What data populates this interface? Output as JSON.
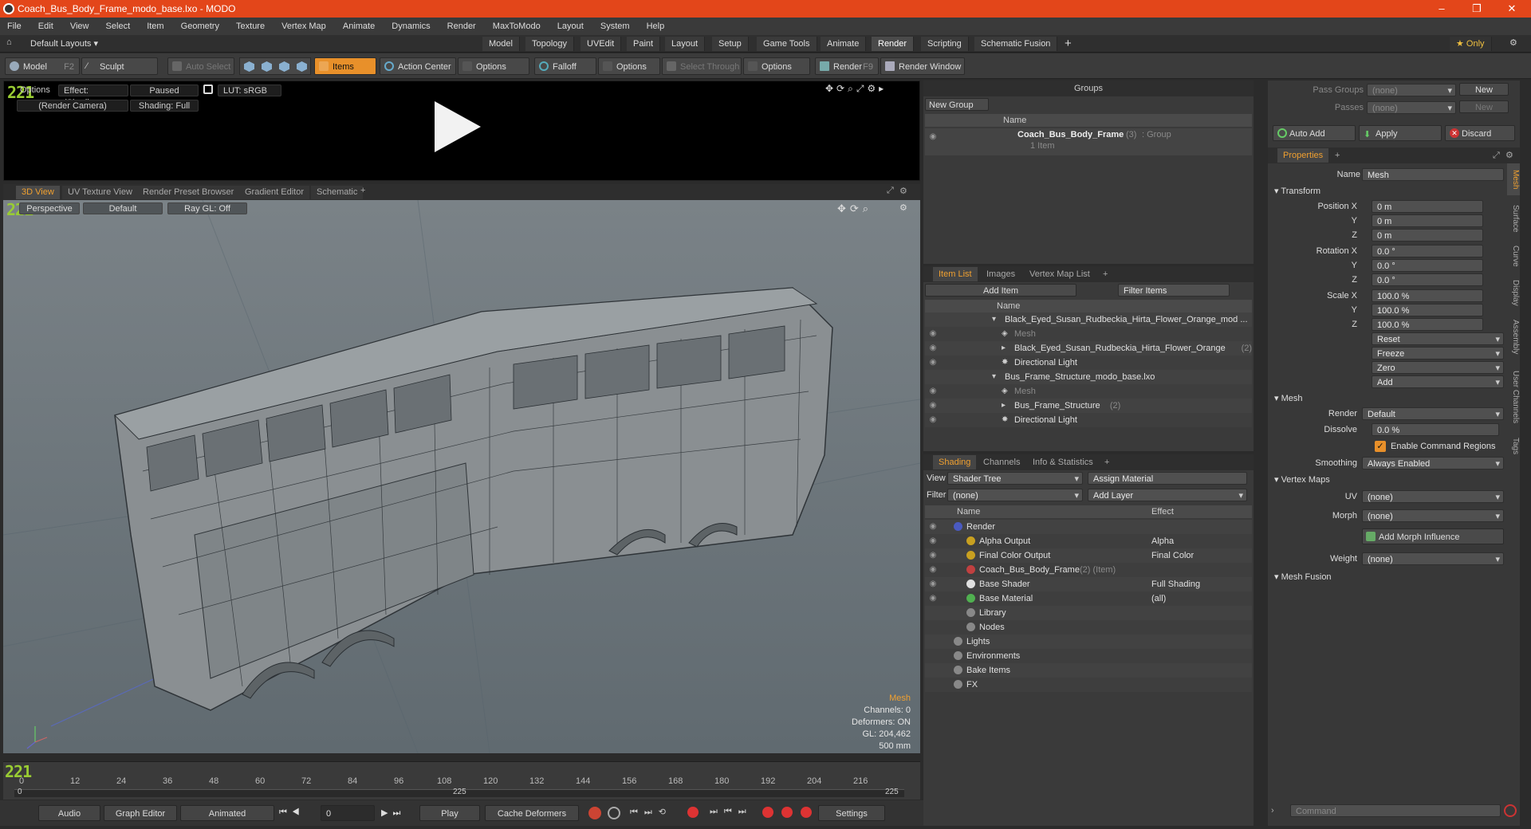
{
  "window": {
    "title": "Coach_Bus_Body_Frame_modo_base.lxo - MODO",
    "min": "–",
    "max": "❐",
    "close": "✕"
  },
  "menu": [
    "File",
    "Edit",
    "View",
    "Select",
    "Item",
    "Geometry",
    "Texture",
    "Vertex Map",
    "Animate",
    "Dynamics",
    "Render",
    "MaxToModo",
    "Layout",
    "System",
    "Help"
  ],
  "layout": {
    "default": "Default Layouts ▾",
    "tabs": [
      "Model",
      "Topology",
      "UVEdit",
      "Paint",
      "Layout",
      "Setup",
      "Game Tools",
      "Animate",
      "Render",
      "Scripting",
      "Schematic Fusion"
    ],
    "active": "Render",
    "plus": "+",
    "only": "★ Only"
  },
  "toolbar": {
    "model": "Model",
    "model_key": "F2",
    "sculpt": "Sculpt",
    "auto_select": "Auto Select",
    "items": "Items",
    "action_center": "Action Center",
    "options1": "Options",
    "falloff": "Falloff",
    "options2": "Options",
    "select_through": "Select Through",
    "options3": "Options",
    "render": "Render",
    "render_key": "F9",
    "render_window": "Render Window"
  },
  "preview": {
    "options": "Options",
    "effect": "Effect: (Shadi...",
    "paused": "Paused",
    "lut": "LUT: sRGB",
    "camera": "(Render Camera)",
    "shading": "Shading: Full",
    "frame_badge": "221"
  },
  "viewport_tabs": [
    "3D View",
    "UV Texture View",
    "Render Preset Browser",
    "Gradient Editor",
    "Schematic",
    "+"
  ],
  "viewport": {
    "perspective": "Perspective",
    "default": "Default",
    "raygl": "Ray GL: Off",
    "badge": "221",
    "info": {
      "type": "Mesh",
      "channels": "Channels: 0",
      "deformers": "Deformers: ON",
      "gl": "GL: 204,462",
      "size": "500 mm"
    }
  },
  "timeline": {
    "ticks": [
      "0",
      "12",
      "24",
      "36",
      "48",
      "60",
      "72",
      "84",
      "96",
      "108",
      "120",
      "132",
      "144",
      "156",
      "168",
      "180",
      "192",
      "204",
      "216"
    ],
    "mid": "225",
    "end": "225",
    "badge": "221"
  },
  "bottom": {
    "audio": "Audio",
    "graph": "Graph Editor",
    "animated": "Animated",
    "frame": "0",
    "play": "Play",
    "cache": "Cache Deformers",
    "settings": "Settings"
  },
  "groups": {
    "title": "Groups",
    "new_group": "New Group",
    "col_name": "Name",
    "item_name": "Coach_Bus_Body_Frame",
    "item_count": "(3)",
    "item_type": ": Group",
    "item_sub": "1 Item"
  },
  "itemlist": {
    "tabs": [
      "Item List",
      "Images",
      "Vertex Map List",
      "+"
    ],
    "add_item": "Add Item",
    "filter": "Filter Items",
    "col_name": "Name",
    "rows": [
      {
        "label": "Black_Eyed_Susan_Rudbeckia_Hirta_Flower_Orange_mod ...",
        "indent": 0,
        "kind": "scene"
      },
      {
        "label": "Mesh",
        "indent": 1,
        "kind": "mesh"
      },
      {
        "label": "Black_Eyed_Susan_Rudbeckia_Hirta_Flower_Orange",
        "count": "(2)",
        "indent": 1,
        "kind": "group"
      },
      {
        "label": "Directional Light",
        "indent": 1,
        "kind": "light"
      },
      {
        "label": "Bus_Frame_Structure_modo_base.lxo",
        "indent": 0,
        "kind": "scene"
      },
      {
        "label": "Mesh",
        "indent": 1,
        "kind": "mesh"
      },
      {
        "label": "Bus_Frame_Structure",
        "count": "(2)",
        "indent": 1,
        "kind": "group"
      },
      {
        "label": "Directional Light",
        "indent": 1,
        "kind": "light"
      }
    ]
  },
  "shading": {
    "tabs": [
      "Shading",
      "Channels",
      "Info & Statistics",
      "+"
    ],
    "view_label": "View",
    "view": "Shader Tree",
    "assign": "Assign Material",
    "filter_label": "Filter",
    "filter": "(none)",
    "add_layer": "Add Layer",
    "col_name": "Name",
    "col_effect": "Effect",
    "rows": [
      {
        "name": "Render",
        "effect": "",
        "indent": 0
      },
      {
        "name": "Alpha Output",
        "effect": "Alpha",
        "indent": 1
      },
      {
        "name": "Final Color Output",
        "effect": "Final Color",
        "indent": 1
      },
      {
        "name": "Coach_Bus_Body_Frame",
        "extra": "(2) (Item)",
        "effect": "",
        "indent": 1
      },
      {
        "name": "Base Shader",
        "effect": "Full Shading",
        "indent": 1
      },
      {
        "name": "Base Material",
        "effect": "(all)",
        "indent": 1
      },
      {
        "name": "Library",
        "effect": "",
        "indent": 1
      },
      {
        "name": "Nodes",
        "effect": "",
        "indent": 1
      },
      {
        "name": "Lights",
        "effect": "",
        "indent": 0
      },
      {
        "name": "Environments",
        "effect": "",
        "indent": 0
      },
      {
        "name": "Bake Items",
        "effect": "",
        "indent": 0
      },
      {
        "name": "FX",
        "effect": "",
        "indent": 0
      }
    ]
  },
  "passes": {
    "pass_groups": "Pass Groups",
    "passes": "Passes",
    "none1": "(none)",
    "none2": "(none)",
    "new1": "New",
    "new2": "New",
    "auto_add": "Auto Add",
    "apply": "Apply",
    "discard": "Discard"
  },
  "properties": {
    "tab": "Properties",
    "plus": "+",
    "name_label": "Name",
    "name": "Mesh",
    "transform": "Transform",
    "pos_label": "Position X",
    "px": "0 m",
    "py": "0 m",
    "pz": "0 m",
    "rot_label": "Rotation X",
    "rx": "0.0 °",
    "ry": "0.0 °",
    "rz": "0.0 °",
    "scale_label": "Scale X",
    "sx": "100.0 %",
    "sy": "100.0 %",
    "sz": "100.0 %",
    "y": "Y",
    "z": "Z",
    "reset": "Reset",
    "freeze": "Freeze",
    "zero": "Zero",
    "add": "Add",
    "mesh": "Mesh",
    "render_label": "Render",
    "render": "Default",
    "dissolve_label": "Dissolve",
    "dissolve": "0.0 %",
    "enable_cmd": "Enable Command Regions",
    "smoothing_label": "Smoothing",
    "smoothing": "Always Enabled",
    "vertex_maps": "Vertex Maps",
    "uv_label": "UV",
    "uv": "(none)",
    "morph_label": "Morph",
    "morph": "(none)",
    "add_morph": "Add Morph Influence",
    "weight_label": "Weight",
    "weight": "(none)",
    "mesh_fusion": "Mesh Fusion",
    "side_tabs": [
      "Mesh",
      "Surface",
      "Curve",
      "Display",
      "Assembly",
      "User Channels",
      "Tags"
    ]
  },
  "command": {
    "placeholder": "Command"
  }
}
